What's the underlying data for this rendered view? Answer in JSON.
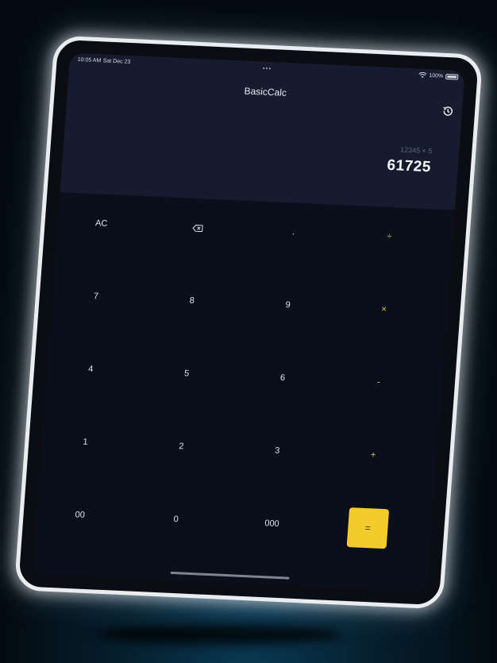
{
  "status_bar": {
    "time": "10:05 AM",
    "date": "Sat Dec 23",
    "multitask_dots": "•••",
    "battery_percent": "100%",
    "wifi_icon": "wifi-icon",
    "battery_icon": "battery-icon"
  },
  "header": {
    "title": "BasicCalc",
    "history_icon": "history-icon"
  },
  "display": {
    "expression": "12345 × 5",
    "result": "61725"
  },
  "keypad": {
    "rows": [
      [
        {
          "label": "AC",
          "type": "function"
        },
        {
          "label": "",
          "type": "backspace",
          "icon": "backspace-icon"
        },
        {
          "label": ".",
          "type": "function"
        },
        {
          "label": "÷",
          "type": "operator"
        }
      ],
      [
        {
          "label": "7",
          "type": "digit"
        },
        {
          "label": "8",
          "type": "digit"
        },
        {
          "label": "9",
          "type": "digit"
        },
        {
          "label": "×",
          "type": "operator"
        }
      ],
      [
        {
          "label": "4",
          "type": "digit"
        },
        {
          "label": "5",
          "type": "digit"
        },
        {
          "label": "6",
          "type": "digit"
        },
        {
          "label": "-",
          "type": "operator"
        }
      ],
      [
        {
          "label": "1",
          "type": "digit"
        },
        {
          "label": "2",
          "type": "digit"
        },
        {
          "label": "3",
          "type": "digit"
        },
        {
          "label": "+",
          "type": "operator"
        }
      ],
      [
        {
          "label": "00",
          "type": "digit"
        },
        {
          "label": "0",
          "type": "digit"
        },
        {
          "label": "000",
          "type": "digit"
        },
        {
          "label": "=",
          "type": "equals"
        }
      ]
    ]
  },
  "colors": {
    "accent": "#f3cc2c",
    "operator_text": "#e8cf3a",
    "display_background": "#161c2e",
    "keypad_background": "#0b0f1c",
    "device_frame": "#e9edf0"
  }
}
